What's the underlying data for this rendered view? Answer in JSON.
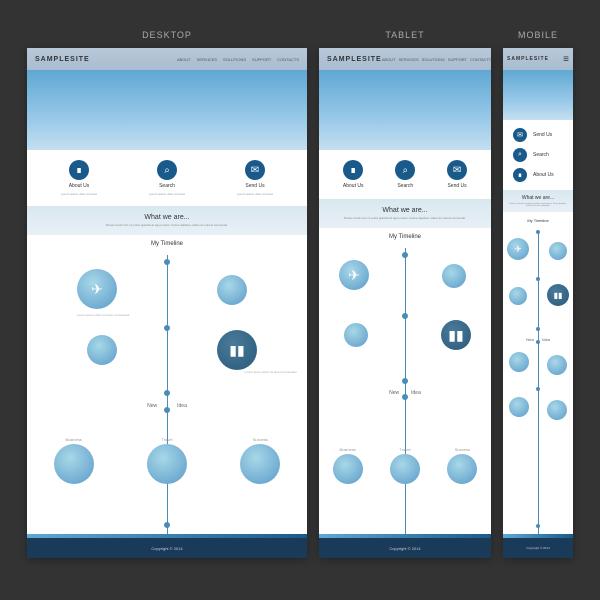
{
  "labels": {
    "desktop": "DESKTOP",
    "tablet": "TABLET",
    "mobile": "MOBILE"
  },
  "brand": "SAMPLESITE",
  "nav": [
    "ABOUT",
    "SERVICES",
    "SOLUTIONS",
    "SUPPORT",
    "CONTACTS"
  ],
  "features": [
    {
      "icon": "book",
      "title": "About Us",
      "sub": "Lorem ipsum dolor sit amet"
    },
    {
      "icon": "search",
      "title": "Search",
      "sub": "Lorem ipsum dolor sit amet"
    },
    {
      "icon": "mail",
      "title": "Send Us",
      "sub": "Lorem ipsum dolor sit amet"
    }
  ],
  "about": {
    "heading": "What we are...",
    "text": "Donec id elit non mi porta gravida at eget metus. Fusce dapibus, tellus ac cursus commodo."
  },
  "timeline": {
    "title": "My Timeline",
    "split": {
      "left": "New",
      "right": "Idea"
    },
    "items": [
      {
        "icon": "plane"
      },
      {
        "icon": "chart"
      }
    ],
    "categories": [
      {
        "label": "Business"
      },
      {
        "label": "Travel"
      },
      {
        "label": "Success"
      }
    ]
  },
  "footer": {
    "copyright": "Copyright © 2014"
  }
}
